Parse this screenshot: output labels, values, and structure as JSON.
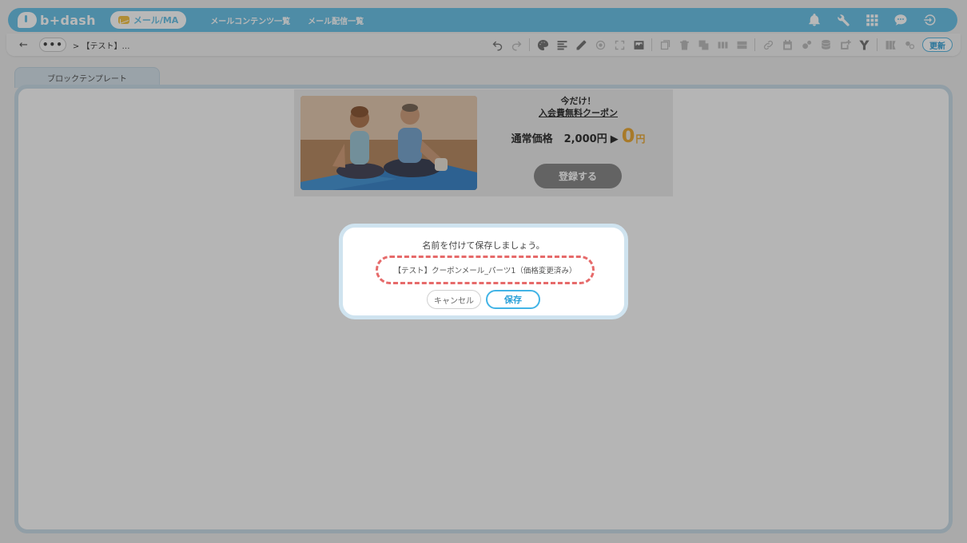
{
  "header": {
    "logo_text": "b+dash",
    "module_label": "メール/MA",
    "nav_links": [
      "メールコンテンツ一覧",
      "メール配信一覧"
    ],
    "icons": [
      "bell-icon",
      "wrench-icon",
      "apps-grid-icon",
      "chat-icon",
      "logout-icon"
    ]
  },
  "toolbar": {
    "back_symbol": "←",
    "more_symbol": "•••",
    "breadcrumb": "> 【テスト】…",
    "update_label": "更新"
  },
  "tab": {
    "label": "ブロックテンプレート"
  },
  "coupon": {
    "line1": "今だけ！",
    "line2": "入会費無料クーポン",
    "price_label": "通常価格",
    "price_amount": "2,000円",
    "arrow": "▶",
    "new_price": "0",
    "yen": "円",
    "button_label": "登録する"
  },
  "modal": {
    "title": "名前を付けて保存しましょう。",
    "name_value": "【テスト】クーポンメール_パーツ1（価格変更済み）",
    "cancel_label": "キャンセル",
    "save_label": "保存"
  },
  "colors": {
    "header_bg": "#6dc3e6",
    "accent_orange": "#e9a93a",
    "dash_red": "#e66a6a",
    "save_blue": "#42b4e6"
  }
}
